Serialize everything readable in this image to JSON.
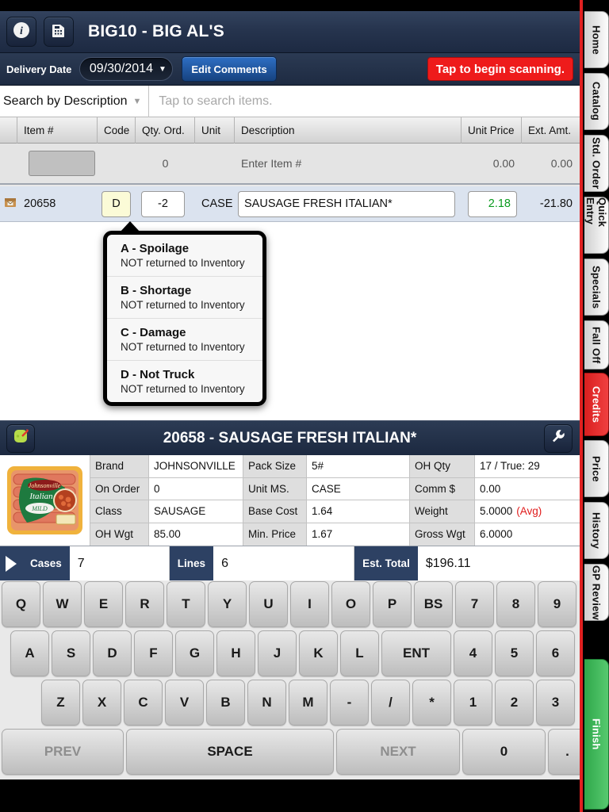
{
  "titlebar": {
    "info_icon": "info-icon",
    "calc_icon": "calculator-icon",
    "title": "BIG10 - BIG AL'S"
  },
  "toolbar": {
    "delivery_date_label": "Delivery Date",
    "delivery_date_value": "09/30/2014",
    "caret": "▼",
    "edit_comments_label": "Edit Comments",
    "scan_label": "Tap to begin scanning.",
    "scan_color": "#ee1b1b"
  },
  "search": {
    "mode": "Search by Description",
    "caret": "▼",
    "placeholder": "Tap to search items."
  },
  "table": {
    "headers": [
      "",
      "Item #",
      "Code",
      "Qty. Ord.",
      "Unit",
      "Description",
      "Unit Price",
      "Ext. Amt."
    ],
    "entry_row": {
      "qty": "0",
      "description": "Enter Item #",
      "unit_price": "0.00",
      "ext_amt": "0.00"
    },
    "rows": [
      {
        "icon": "box-icon",
        "item": "20658",
        "code": "D",
        "qty": "-2",
        "unit": "CASE",
        "description": "SAUSAGE FRESH ITALIAN*",
        "unit_price": "2.18",
        "ext_amt": "-21.80",
        "price_color": "#0b9b1f"
      }
    ]
  },
  "popup": {
    "options": [
      {
        "title": "A - Spoilage",
        "subtitle": "NOT returned to Inventory"
      },
      {
        "title": "B - Shortage",
        "subtitle": "NOT returned to Inventory"
      },
      {
        "title": "C - Damage",
        "subtitle": "NOT returned to Inventory"
      },
      {
        "title": "D - Not Truck",
        "subtitle": "NOT returned to Inventory"
      }
    ]
  },
  "detail": {
    "tag_icon": "price-tag-icon",
    "wrench_icon": "wrench-icon",
    "title": "20658 - SAUSAGE FRESH ITALIAN*",
    "image_alt": "johnsonville-italian-sausage-package",
    "fields": [
      {
        "k": "Brand",
        "v": "JOHNSONVILLE"
      },
      {
        "k": "Pack Size",
        "v": "5#"
      },
      {
        "k": "OH Qty",
        "v": "17 / True: 29"
      },
      {
        "k": "On Order",
        "v": "0"
      },
      {
        "k": "Unit MS.",
        "v": "CASE"
      },
      {
        "k": "Comm $",
        "v": "0.00"
      },
      {
        "k": "Class",
        "v": "SAUSAGE"
      },
      {
        "k": "Base Cost",
        "v": "1.64"
      },
      {
        "k": "Weight",
        "v": "5.0000",
        "note": "(Avg)",
        "note_color": "#e01b1b"
      },
      {
        "k": "OH Wgt",
        "v": "85.00"
      },
      {
        "k": "Min. Price",
        "v": "1.67"
      },
      {
        "k": "Gross Wgt",
        "v": "6.0000"
      }
    ]
  },
  "totals": {
    "play_icon": "play-triangle-icon",
    "cases_label": "Cases",
    "cases_value": "7",
    "lines_label": "Lines",
    "lines_value": "6",
    "est_total_label": "Est. Total",
    "est_total_value": "$196.11"
  },
  "keyboard": {
    "row1": [
      "Q",
      "W",
      "E",
      "R",
      "T",
      "Y",
      "U",
      "I",
      "O",
      "P",
      "BS",
      "7",
      "8",
      "9"
    ],
    "row2": [
      "A",
      "S",
      "D",
      "F",
      "G",
      "H",
      "J",
      "K",
      "L",
      "ENT",
      "4",
      "5",
      "6"
    ],
    "row3": [
      "Z",
      "X",
      "C",
      "V",
      "B",
      "N",
      "M",
      "-",
      "/",
      "*",
      "1",
      "2",
      "3"
    ],
    "row4": [
      "PREV",
      "SPACE",
      "NEXT",
      "0",
      "."
    ]
  },
  "sidebar": {
    "tabs": [
      {
        "label": "Home",
        "style": "plain"
      },
      {
        "label": "Catalog",
        "style": "plain"
      },
      {
        "label": "Std. Order",
        "style": "plain"
      },
      {
        "label": "Quick Entry",
        "style": "plain"
      },
      {
        "label": "Specials",
        "style": "plain"
      },
      {
        "label": "Fall Off",
        "style": "plain"
      },
      {
        "label": "Credits",
        "style": "red"
      },
      {
        "label": "Price",
        "style": "plain"
      },
      {
        "label": "History",
        "style": "plain"
      },
      {
        "label": "GP Review",
        "style": "plain"
      },
      {
        "label": "Finish",
        "style": "green"
      }
    ]
  }
}
